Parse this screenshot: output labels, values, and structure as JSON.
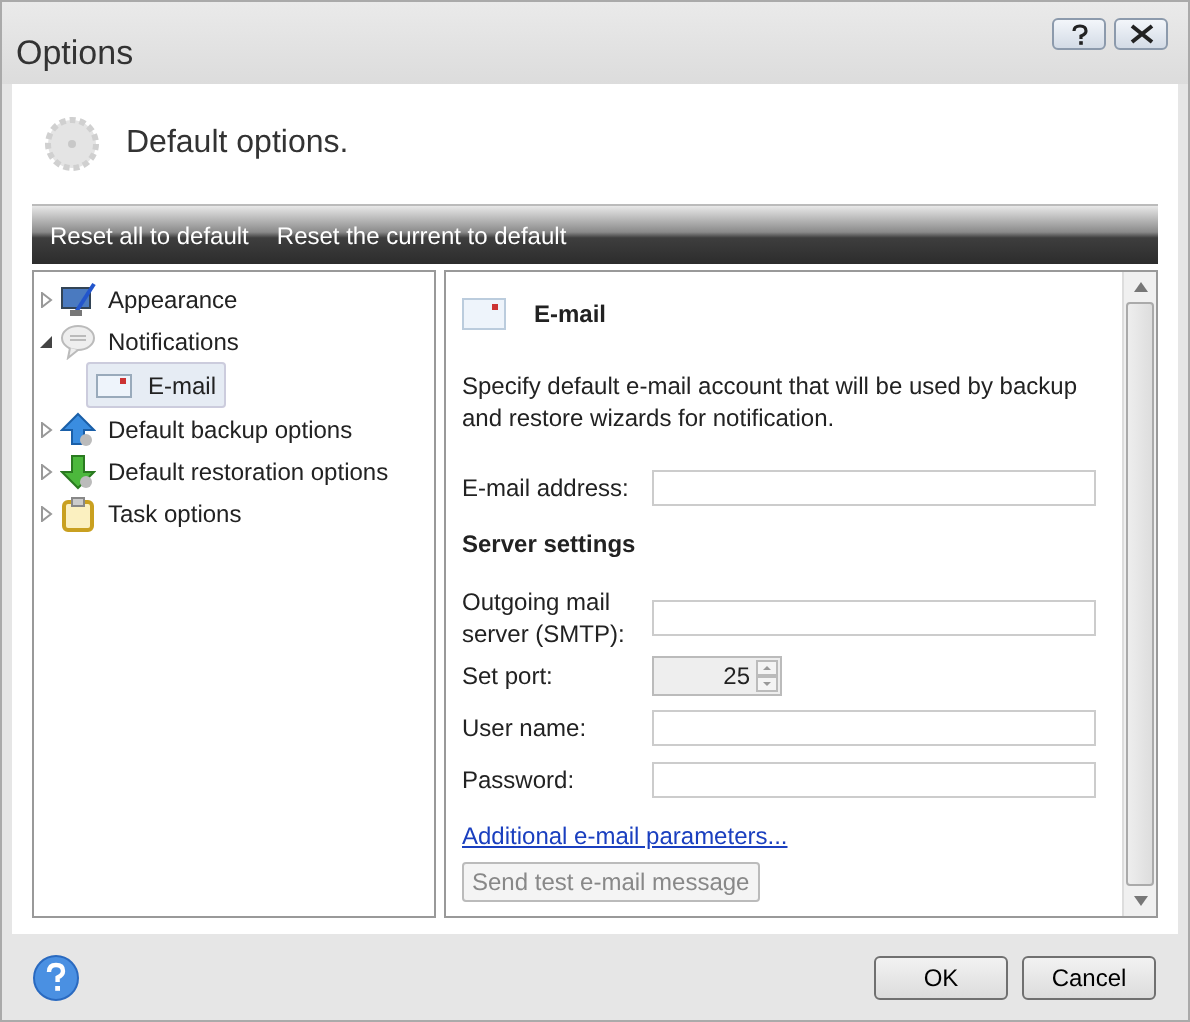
{
  "window": {
    "title": "Options"
  },
  "header": {
    "title": "Default options."
  },
  "toolbar": {
    "items": [
      "Reset all to default",
      "Reset the current to default"
    ]
  },
  "tree": [
    {
      "label": "Appearance",
      "kind": "appearance",
      "expanded": false,
      "selected": false
    },
    {
      "label": "Notifications",
      "kind": "notifications",
      "expanded": true,
      "selected": false,
      "children": [
        {
          "label": "E-mail",
          "selected": true
        }
      ]
    },
    {
      "label": "Default backup options",
      "kind": "backup",
      "expanded": false,
      "selected": false
    },
    {
      "label": "Default restoration options",
      "kind": "restore",
      "expanded": false,
      "selected": false
    },
    {
      "label": "Task options",
      "kind": "task",
      "expanded": false,
      "selected": false
    }
  ],
  "panel": {
    "title": "E-mail",
    "description": "Specify default e-mail account that will be used by backup and restore wizards for notification.",
    "items": [
      {
        "kind": "field",
        "label": "E-mail address:"
      },
      {
        "kind": "heading",
        "label": "Server settings"
      },
      {
        "kind": "field",
        "label": "Outgoing mail server (SMTP):"
      },
      {
        "kind": "spinner",
        "label": "Set port:",
        "value": "25"
      },
      {
        "kind": "field",
        "label": "User name:"
      },
      {
        "kind": "field",
        "label": "Password:"
      }
    ],
    "link": "Additional e-mail parameters...",
    "button": {
      "label": "Send test e-mail message",
      "disabled": true
    }
  },
  "footer": {
    "buttons": [
      "OK",
      "Cancel"
    ]
  }
}
